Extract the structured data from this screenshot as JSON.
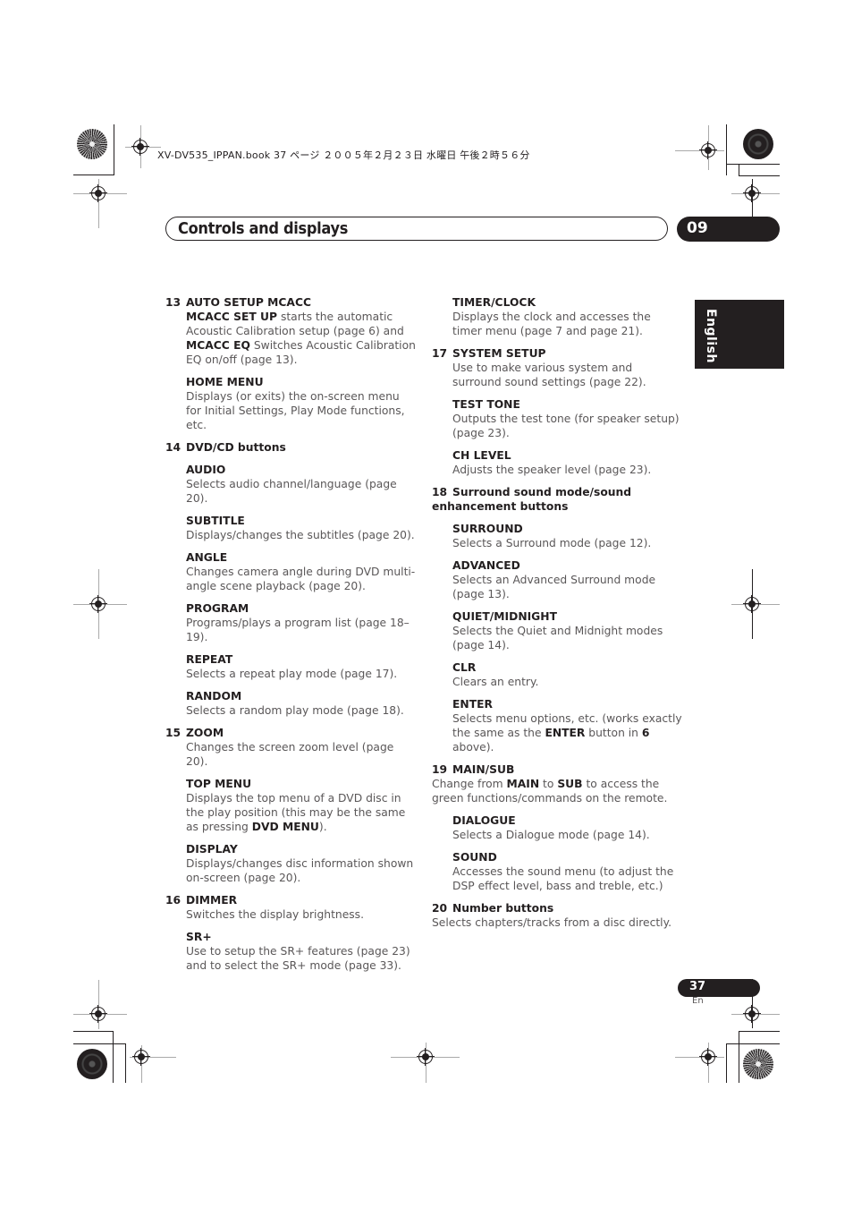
{
  "print_info": "XV-DV535_IPPAN.book  37 ページ  ２００５年２月２３日  水曜日  午後２時５６分",
  "header": {
    "title": "Controls and displays",
    "chapter": "09"
  },
  "language_tab": "English",
  "left_column": [
    {
      "num": "13",
      "head": "AUTO SETUP MCACC",
      "rich": [
        {
          "b": "MCACC SET UP"
        },
        {
          "t": " starts the automatic Acoustic Calibration setup (page 6) and "
        },
        {
          "b": "MCACC EQ"
        },
        {
          "t": " Switches Acoustic Calibration EQ on/off (page 13)."
        }
      ]
    },
    {
      "num": "",
      "head": "HOME MENU",
      "desc": "Displays (or exits) the on-screen menu for Initial Settings, Play Mode functions, etc."
    },
    {
      "num": "14",
      "head": "DVD/CD buttons",
      "desc": ""
    },
    {
      "num": "",
      "head": "AUDIO",
      "desc": "Selects audio channel/language (page 20)."
    },
    {
      "num": "",
      "head": "SUBTITLE",
      "desc": "Displays/changes the subtitles (page 20)."
    },
    {
      "num": "",
      "head": "ANGLE",
      "desc": "Changes camera angle during DVD multi-angle scene playback (page 20)."
    },
    {
      "num": "",
      "head": "PROGRAM",
      "desc": "Programs/plays a program list (page 18–19)."
    },
    {
      "num": "",
      "head": "REPEAT",
      "desc": "Selects a repeat play mode (page 17)."
    },
    {
      "num": "",
      "head": "RANDOM",
      "desc": "Selects a random play mode (page 18)."
    },
    {
      "num": "15",
      "head": "ZOOM",
      "desc": "Changes the screen zoom level (page 20)."
    },
    {
      "num": "",
      "head": "TOP MENU",
      "rich": [
        {
          "t": "Displays the top menu of a DVD disc in the play position (this may be the same as pressing "
        },
        {
          "b": "DVD MENU"
        },
        {
          "t": ")."
        }
      ]
    },
    {
      "num": "",
      "head": "DISPLAY",
      "desc": "Displays/changes disc information shown on-screen (page 20)."
    },
    {
      "num": "16",
      "head": "DIMMER",
      "desc": "Switches the display brightness."
    },
    {
      "num": "",
      "head": "SR+",
      "desc": "Use to setup the SR+ features (page 23) and to select the SR+ mode (page 33)."
    }
  ],
  "right_column": [
    {
      "num": "",
      "head": "TIMER/CLOCK",
      "desc": "Displays the clock and accesses the timer menu (page 7 and page 21)."
    },
    {
      "num": "17",
      "head": "SYSTEM SETUP",
      "desc": "Use to make various system and surround sound settings (page 22)."
    },
    {
      "num": "",
      "head": "TEST TONE",
      "desc": "Outputs the test tone (for speaker setup) (page 23)."
    },
    {
      "num": "",
      "head": "CH LEVEL",
      "desc": "Adjusts the speaker level (page 23)."
    },
    {
      "num": "18",
      "head": "Surround sound mode/sound enhancement buttons",
      "desc": "",
      "wrap": true
    },
    {
      "num": "",
      "head": "SURROUND",
      "desc": "Selects a Surround mode (page 12)."
    },
    {
      "num": "",
      "head": "ADVANCED",
      "desc": "Selects an Advanced Surround mode (page 13)."
    },
    {
      "num": "",
      "head": "QUIET/MIDNIGHT",
      "desc": "Selects the Quiet and Midnight modes (page 14)."
    },
    {
      "num": "",
      "head": "CLR",
      "desc": "Clears an entry."
    },
    {
      "num": "",
      "head": "ENTER",
      "rich": [
        {
          "t": "Selects menu options, etc. (works exactly the same as the "
        },
        {
          "b": "ENTER"
        },
        {
          "t": " button in "
        },
        {
          "b": "6"
        },
        {
          "t": " above)."
        }
      ]
    },
    {
      "num": "19",
      "head": "MAIN/SUB",
      "wrap": true,
      "rich": [
        {
          "t": "Change from "
        },
        {
          "b": "MAIN"
        },
        {
          "t": " to "
        },
        {
          "b": "SUB"
        },
        {
          "t": " to access the green functions/commands on the remote."
        }
      ]
    },
    {
      "num": "",
      "head": "DIALOGUE",
      "desc": "Selects a Dialogue mode (page 14)."
    },
    {
      "num": "",
      "head": "SOUND",
      "desc": "Accesses the sound menu (to adjust the DSP effect level, bass and treble, etc.)"
    },
    {
      "num": "20",
      "head": "Number buttons",
      "desc": "Selects chapters/tracks from a disc directly.",
      "wrap": true
    }
  ],
  "footer": {
    "page_number": "37",
    "language": "En"
  }
}
